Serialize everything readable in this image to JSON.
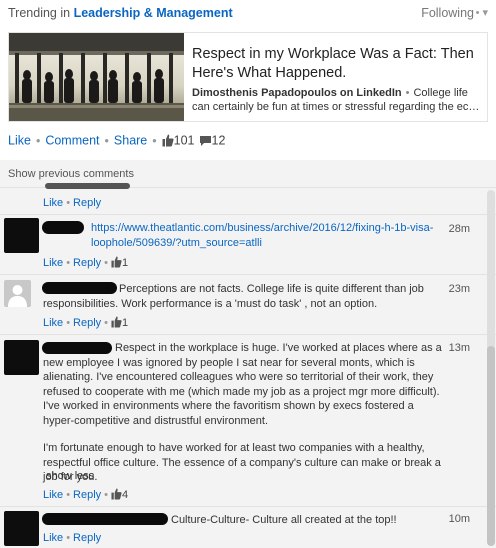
{
  "header": {
    "prefix": "Trending in",
    "category": "Leadership & Management",
    "follow_label": "Following",
    "chevron": "▾"
  },
  "article": {
    "title": "Respect in my Workplace Was a Fact: Then Here's What Happened.",
    "author": "Dimosthenis Papadopoulos on LinkedIn",
    "snippet_start": "College life",
    "snippet_rest": "can certainly be fun at times or stressful regarding the eco…"
  },
  "post_actions": {
    "like": "Like",
    "comment": "Comment",
    "share": "Share",
    "likes_count": "101",
    "comments_count": "12"
  },
  "comments_area": {
    "show_previous": "Show previous comments",
    "items": [
      {
        "text": "",
        "time": "",
        "like": "Like",
        "reply": "Reply",
        "likes": ""
      },
      {
        "text": "https://www.theatlantic.com/business/archive/2016/12/fixing-h-1b-visa-loophole/509639/?utm_source=atlli",
        "time": "28m",
        "like": "Like",
        "reply": "Reply",
        "likes": "1"
      },
      {
        "text": "Perceptions are not facts. College life is quite different than job responsibilities. Work performance is a 'must do task' , not an option.",
        "time": "23m",
        "like": "Like",
        "reply": "Reply",
        "likes": "1"
      },
      {
        "text": "Respect in the workplace is huge. I've worked at places where as a new employee I was ignored by people I sat near for several monts, which is alienating. I've encountered colleagues who were so territorial of their work, they refused to cooperate with me (which made my job as a project mgr more difficult). I've worked in environments where the favoritism shown by execs fostered a hyper-competitive and distrustful environment.",
        "text2": "I'm fortunate enough to have worked for at least two companies with a healthy, respectful office culture. The essence of a company's culture can make or break a job for you.",
        "show_less": "show less",
        "time": "13m",
        "like": "Like",
        "reply": "Reply",
        "likes": "4"
      },
      {
        "text": "Culture-Culture- Culture all created at the top!!",
        "time": "10m",
        "like": "Like",
        "reply": "Reply",
        "likes": ""
      }
    ]
  },
  "colors": {
    "link": "#0a66c2",
    "comments_bg": "#f3f3f3"
  }
}
